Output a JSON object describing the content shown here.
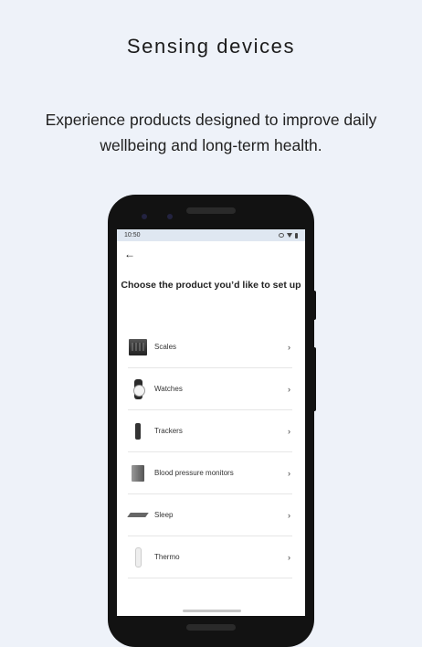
{
  "header": {
    "title": "Sensing devices",
    "subtitle": "Experience products designed to improve daily wellbeing and long-term health."
  },
  "phone": {
    "status_time": "10:50",
    "screen_title": "Choose the product you’d like to set up",
    "products": [
      {
        "label": "Scales",
        "icon": "scale-icon"
      },
      {
        "label": "Watches",
        "icon": "watch-icon"
      },
      {
        "label": "Trackers",
        "icon": "tracker-icon"
      },
      {
        "label": "Blood pressure monitors",
        "icon": "blood-pressure-monitor-icon"
      },
      {
        "label": "Sleep",
        "icon": "sleep-mat-icon"
      },
      {
        "label": "Thermo",
        "icon": "thermometer-icon"
      }
    ]
  }
}
